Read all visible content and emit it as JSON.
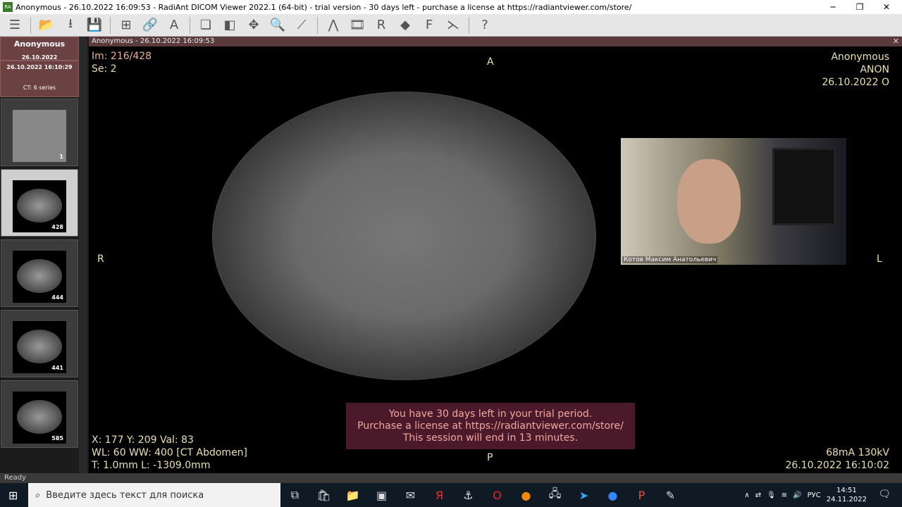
{
  "window": {
    "title": "Anonymous - 26.10.2022 16:09:53 - RadiAnt DICOM Viewer 2022.1 (64-bit) - trial version - 30 days left - purchase a license at https://radiantviewer.com/store/",
    "logo": "RA"
  },
  "toolbar": {
    "icons": [
      "menu-icon",
      "open-folder-icon",
      "download-icon",
      "save-icon",
      "layout-icon",
      "link-icon",
      "text-annotation-icon",
      "series-icon",
      "window-level-icon",
      "pan-icon",
      "zoom-icon",
      "measure-icon",
      "mpr-icon",
      "cine-icon",
      "volume-render-icon",
      "3d-icon",
      "fusion-icon",
      "curved-mpr-icon",
      "help-icon"
    ]
  },
  "sidebar": {
    "patient": "Anonymous",
    "study_date": "26.10.2022",
    "study_datetime": "26.10.2022 16:10:29",
    "series_summary": "CT: 6 series",
    "thumbnails": [
      {
        "count": "1"
      },
      {
        "count": "428",
        "selected": true
      },
      {
        "count": "444"
      },
      {
        "count": "441"
      },
      {
        "count": "585"
      }
    ]
  },
  "viewport": {
    "header": "Anonymous - 26.10.2022 16:09:53",
    "image_index": "Im: 216/428",
    "series": "Se: 2",
    "orient": {
      "top": "A",
      "bottom": "P",
      "left": "R",
      "right": "L"
    },
    "patient_name": "Anonymous",
    "patient_id": "ANON",
    "study_date": "26.10.2022 O",
    "cursor": "X: 177 Y: 209 Val: 83",
    "window": "WL: 60 WW: 400 [CT Abdomen]",
    "thickness": "T: 1.0mm L: -1309.0mm",
    "exposure": "68mA 130kV",
    "acq_datetime": "26.10.2022 16:10:02",
    "trial": [
      "You have 30 days left in your trial period.",
      "Purchase a license at https://radiantviewer.com/store/",
      "This session will end in 13 minutes."
    ]
  },
  "webcam": {
    "name": "Котов Максим Анатольевич"
  },
  "status": "Ready",
  "taskbar": {
    "search_placeholder": "Введите здесь текст для поиска",
    "lang": "РУС",
    "time": "14:51",
    "date": "24.11.2022"
  }
}
